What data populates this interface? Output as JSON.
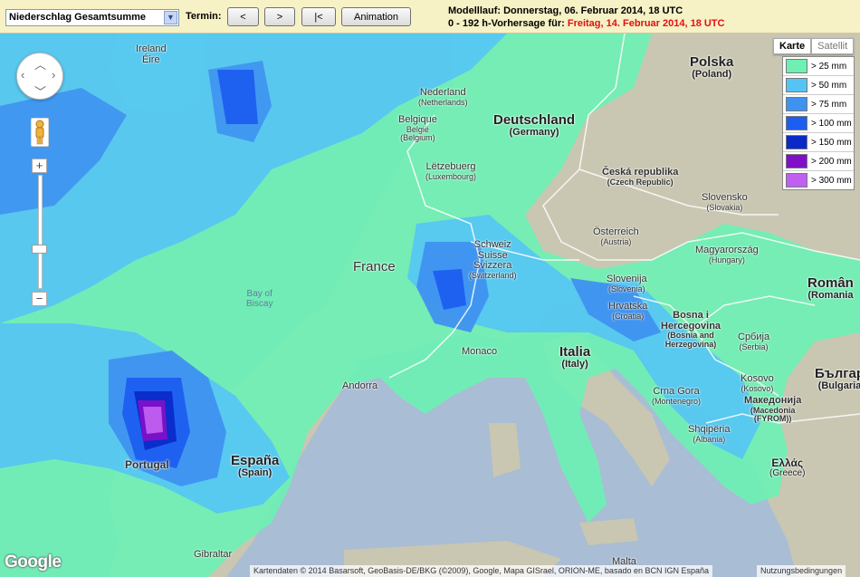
{
  "toolbar": {
    "product_select": "Niederschlag Gesamtsumme",
    "termin_label": "Termin:",
    "prev_label": "<",
    "next_label": ">",
    "first_label": "|<",
    "animation_label": "Animation",
    "modellauf_text": "Modelllauf: Donnerstag, 06. Februar 2014, 18 UTC",
    "forecast_prefix": "0 - 192 h-Vorhersage für:",
    "forecast_date": "Freitag, 14. Februar 2014, 18 UTC"
  },
  "map_type": {
    "karte": "Karte",
    "satellit": "Satellit"
  },
  "legend": [
    {
      "label": "> 25 mm",
      "color": "#6ef0b4"
    },
    {
      "label": "> 50 mm",
      "color": "#55c4f5"
    },
    {
      "label": "> 75 mm",
      "color": "#3f92f0"
    },
    {
      "label": "> 100 mm",
      "color": "#1c5ef0"
    },
    {
      "label": "> 150 mm",
      "color": "#0a2ac8"
    },
    {
      "label": "> 200 mm",
      "color": "#8010c8"
    },
    {
      "label": "> 300 mm",
      "color": "#c060f0"
    }
  ],
  "places": {
    "ireland": {
      "name": "Ireland",
      "sub": "Éire"
    },
    "nederland": {
      "name": "Nederland",
      "sub": "(Netherlands)"
    },
    "belgique": {
      "name": "Belgique",
      "sub": "België",
      "sub2": "(Belgium)"
    },
    "letzebuerg": {
      "name": "Lëtzebuerg",
      "sub": "(Luxembourg)"
    },
    "deutschland": {
      "name": "Deutschland",
      "sub": "(Germany)"
    },
    "polska": {
      "name": "Polska",
      "sub": "(Poland)"
    },
    "cesko": {
      "name": "Česká republika",
      "sub": "(Czech Republic)"
    },
    "slovensko": {
      "name": "Slovensko",
      "sub": "(Slovakia)"
    },
    "osterreich": {
      "name": "Österreich",
      "sub": "(Austria)"
    },
    "schweiz": {
      "name": "Schweiz",
      "sub": "Suisse",
      "sub2": "Svizzera",
      "sub3": "(Switzerland)"
    },
    "france": {
      "name": "France"
    },
    "biscay": {
      "name": "Bay of",
      "sub": "Biscay"
    },
    "magyarorszag": {
      "name": "Magyarország",
      "sub": "(Hungary)"
    },
    "romania": {
      "name": "Român",
      "sub": "(Romania"
    },
    "slovenija": {
      "name": "Slovenija",
      "sub": "(Slovenia)"
    },
    "hrvatska": {
      "name": "Hrvatska",
      "sub": "(Croatia)"
    },
    "bosna": {
      "name": "Bosna i",
      "sub": "Hercegovina",
      "sub2": "(Bosnia and",
      "sub3": "Herzegovina)"
    },
    "srbija": {
      "name": "Србија",
      "sub": "(Serbia)"
    },
    "monaco": {
      "name": "Monaco"
    },
    "andorra": {
      "name": "Andorra"
    },
    "italia": {
      "name": "Italia",
      "sub": "(Italy)"
    },
    "crna_gora": {
      "name": "Crna Gora",
      "sub": "(Montenegro)"
    },
    "kosovo": {
      "name": "Kosovo",
      "sub": "(Kosovo)"
    },
    "bulgaria": {
      "name": "Българ",
      "sub": "(Bulgaria"
    },
    "makedonija": {
      "name": "Македонија",
      "sub": "(Macedonia",
      "sub2": "(FYROM))"
    },
    "shqiperia": {
      "name": "Shqipëria",
      "sub": "(Albania)"
    },
    "portugal": {
      "name": "Portugal"
    },
    "espana": {
      "name": "España",
      "sub": "(Spain)"
    },
    "ellas": {
      "name": "Ελλάς",
      "sub": "(Greece)"
    },
    "gibraltar": {
      "name": "Gibraltar"
    },
    "malta": {
      "name": "Malta"
    }
  },
  "footer": {
    "google": "Google",
    "attribution": "Kartendaten © 2014 Basarsoft, GeoBasis-DE/BKG (©2009), Google, Mapa GISrael, ORION-ME, basado en BCN IGN España",
    "terms": "Nutzungsbedingungen"
  }
}
